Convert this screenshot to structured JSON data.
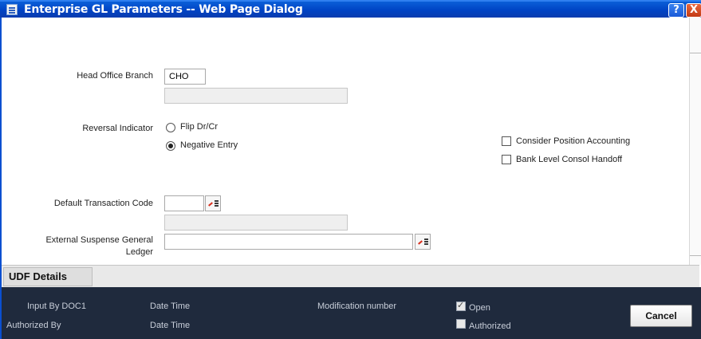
{
  "window": {
    "title": "Enterprise GL Parameters -- Web Page Dialog",
    "help_label": "?",
    "close_label": "X"
  },
  "form": {
    "head_office_branch": {
      "label": "Head Office Branch",
      "value": "CHO",
      "description": ""
    },
    "reversal_indicator": {
      "label": "Reversal Indicator",
      "options": [
        "Flip Dr/Cr",
        "Negative Entry"
      ],
      "selected": "Negative Entry"
    },
    "consider_position_accounting": {
      "label": "Consider Position Accounting",
      "checked": false
    },
    "bank_level_consol_handoff": {
      "label": "Bank Level Consol Handoff",
      "checked": false
    },
    "default_transaction_code": {
      "label": "Default Transaction Code",
      "value": "",
      "description": ""
    },
    "external_suspense_gl": {
      "label_line1": "External Suspense General",
      "label_line2": "Ledger",
      "value": ""
    }
  },
  "udf": {
    "button_label": "UDF Details"
  },
  "footer": {
    "input_by": "Input By DOC1",
    "date_time_1": "Date Time",
    "authorized_by": "Authorized By",
    "date_time_2": "Date Time",
    "modification_number": "Modification number",
    "open": {
      "label": "Open",
      "checked": true
    },
    "authorized": {
      "label": "Authorized",
      "checked": false
    },
    "cancel_label": "Cancel"
  },
  "icons": {
    "window": "dialog-window-icon",
    "lov": "list-of-values-icon"
  },
  "colors": {
    "title_bar": "#0043c4",
    "footer": "#1f2a3d",
    "udf_bar": "#e9e9e9"
  }
}
